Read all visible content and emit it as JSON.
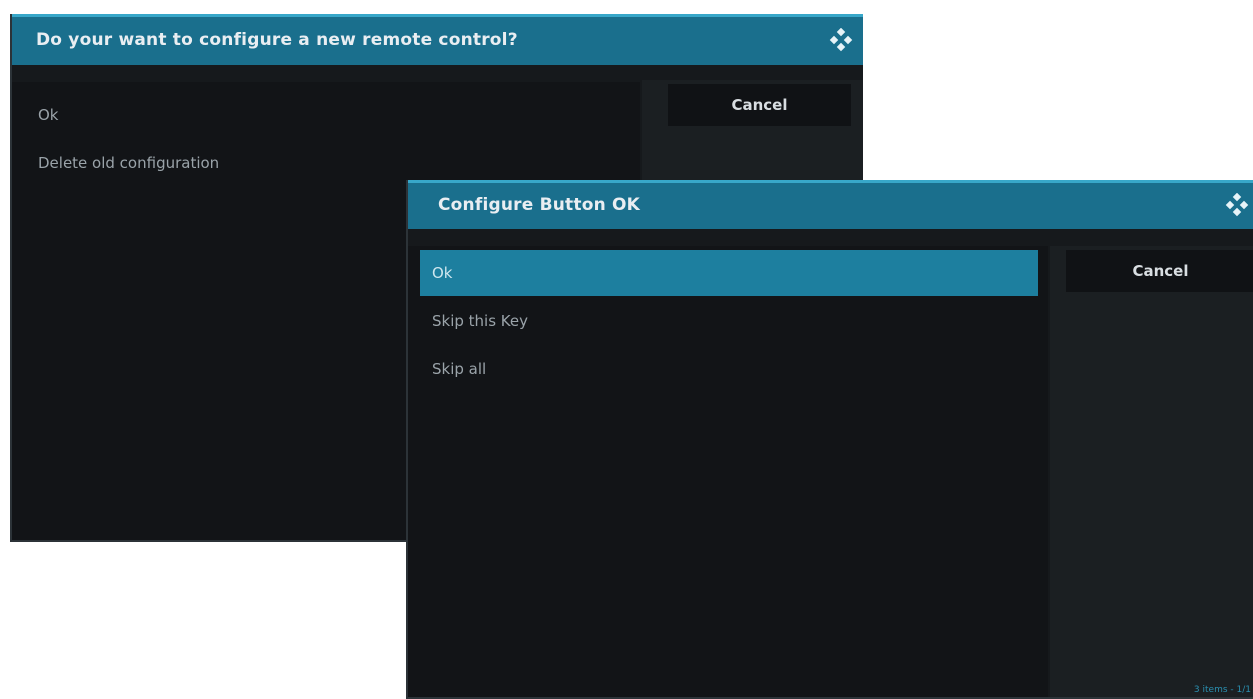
{
  "back_dialog": {
    "title": "Do your want to configure a new remote control?",
    "items": [
      {
        "label": "Ok"
      },
      {
        "label": "Delete old configuration"
      }
    ],
    "cancel_label": "Cancel"
  },
  "front_dialog": {
    "title": "Configure Button OK",
    "items": [
      {
        "label": "Ok",
        "selected": true
      },
      {
        "label": "Skip this Key",
        "selected": false
      },
      {
        "label": "Skip all",
        "selected": false
      }
    ],
    "cancel_label": "Cancel",
    "item_count": "3 items - 1/1"
  },
  "icons": {
    "logo": "kodi-logo-icon"
  },
  "colors": {
    "titlebar": "#1a6f8d",
    "selected_item": "#1d7f9f",
    "dialog_bg": "#16191c"
  }
}
